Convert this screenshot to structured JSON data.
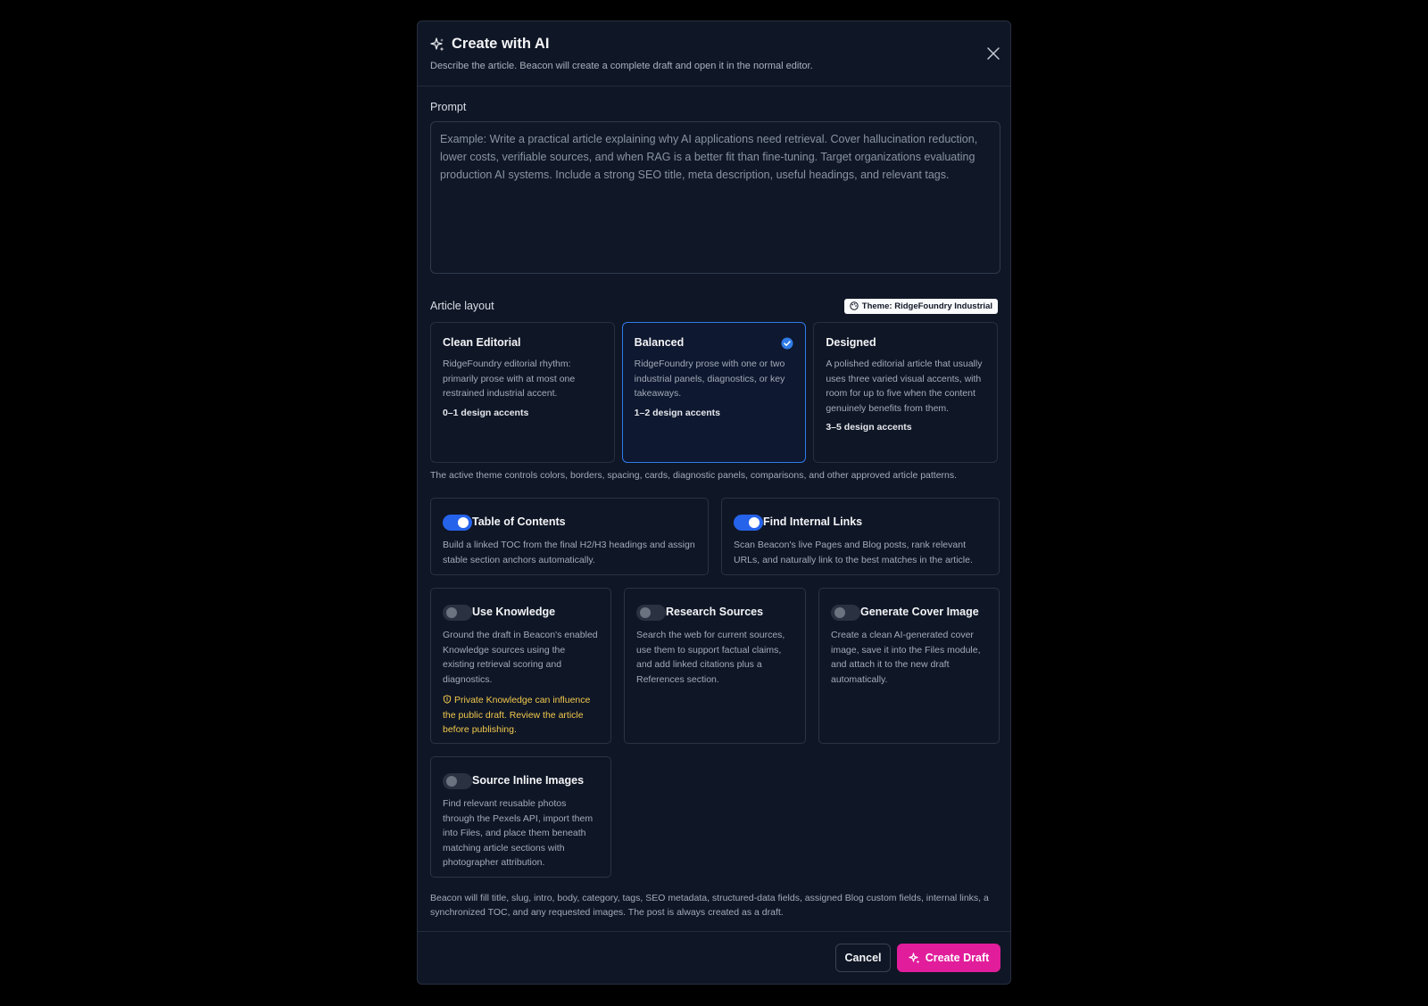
{
  "dialog": {
    "title": "Create with AI",
    "subtitle": "Describe the article. Beacon will create a complete draft and open it in the normal editor."
  },
  "prompt": {
    "label": "Prompt",
    "value": "",
    "placeholder": "Example: Write a practical article explaining why AI applications need retrieval. Cover hallucination reduction, lower costs, verifiable sources, and when RAG is a better fit than fine-tuning. Target organizations evaluating production AI systems. Include a strong SEO title, meta description, useful headings, and relevant tags."
  },
  "layout": {
    "label": "Article layout",
    "theme_badge": "Theme: RidgeFoundry Industrial",
    "options": [
      {
        "title": "Clean Editorial",
        "desc": "RidgeFoundry editorial rhythm: primarily prose with at most one restrained industrial accent.",
        "accents": "0–1 design accents",
        "selected": false
      },
      {
        "title": "Balanced",
        "desc": "RidgeFoundry prose with one or two industrial panels, diagnostics, or key takeaways.",
        "accents": "1–2 design accents",
        "selected": true
      },
      {
        "title": "Designed",
        "desc": "A polished editorial article that usually uses three varied visual accents, with room for up to five when the content genuinely benefits from them.",
        "accents": "3–5 design accents",
        "selected": false
      }
    ],
    "note": "The active theme controls colors, borders, spacing, cards, diagnostic panels, comparisons, and other approved article patterns."
  },
  "options": [
    {
      "title": "Table of Contents",
      "desc": "Build a linked TOC from the final H2/H3 headings and assign stable section anchors automatically.",
      "enabled": true
    },
    {
      "title": "Find Internal Links",
      "desc": "Scan Beacon's live Pages and Blog posts, rank relevant URLs, and naturally link to the best matches in the article.",
      "enabled": true
    },
    {
      "title": "Use Knowledge",
      "desc": "Ground the draft in Beacon's enabled Knowledge sources using the existing retrieval scoring and diagnostics.",
      "warning": "Private Knowledge can influence the public draft. Review the article before publishing.",
      "enabled": false
    },
    {
      "title": "Research Sources",
      "desc": "Search the web for current sources, use them to support factual claims, and add linked citations plus a References section.",
      "enabled": false
    },
    {
      "title": "Generate Cover Image",
      "desc": "Create a clean AI-generated cover image, save it into the Files module, and attach it to the new draft automatically.",
      "enabled": false
    },
    {
      "title": "Source Inline Images",
      "desc": "Find relevant reusable photos through the Pexels API, import them into Files, and place them beneath matching article sections with photographer attribution.",
      "enabled": false
    }
  ],
  "footer": {
    "note": "Beacon will fill title, slug, intro, body, category, tags, SEO metadata, structured-data fields, assigned Blog custom fields, internal links, a synchronized TOC, and any requested images. The post is always created as a draft.",
    "cancel_label": "Cancel",
    "create_label": "Create Draft"
  },
  "colors": {
    "accent_blue": "#2563eb",
    "primary_pink": "#e11d9b",
    "warning": "#f2c94c",
    "background": "#0f1626"
  },
  "icons": {
    "title": "sparkles-icon",
    "close": "close-icon",
    "theme": "palette-icon",
    "selected": "check-circle-icon",
    "warning": "shield-icon",
    "create": "sparkles-icon"
  }
}
